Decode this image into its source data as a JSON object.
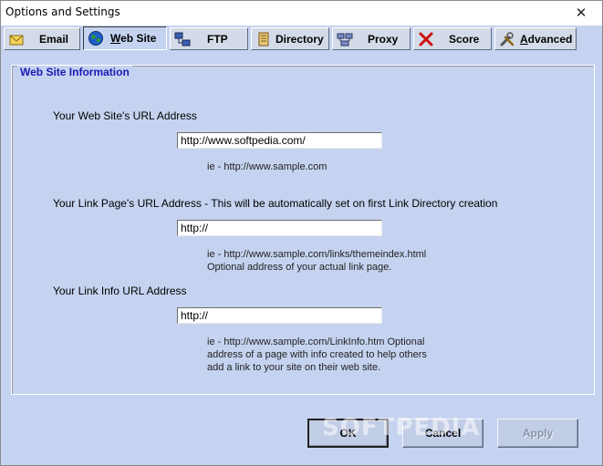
{
  "window": {
    "title": "Options and Settings",
    "close_glyph": "✕"
  },
  "tabs": [
    {
      "label": "Email",
      "mnemonic": "",
      "icon": "envelope-icon",
      "active": false
    },
    {
      "label": "Web Site",
      "mnemonic": "W",
      "icon": "globe-icon",
      "active": true
    },
    {
      "label": "FTP",
      "mnemonic": "",
      "icon": "network-icon",
      "active": false
    },
    {
      "label": "Directory",
      "mnemonic": "",
      "icon": "directory-icon",
      "active": false
    },
    {
      "label": "Proxy",
      "mnemonic": "",
      "icon": "proxy-icon",
      "active": false
    },
    {
      "label": "Score",
      "mnemonic": "",
      "icon": "score-x-icon",
      "active": false
    },
    {
      "label": "Advanced",
      "mnemonic": "A",
      "icon": "tools-icon",
      "active": false
    }
  ],
  "panel": {
    "title": "Web Site Information",
    "url_label": "Your Web Site's URL Address",
    "url_value": "http://www.softpedia.com/",
    "url_hint": "ie - http://www.sample.com",
    "link_label": "Your Link Page's URL Address - This will be automatically set on first Link Directory creation",
    "link_value": "http://",
    "link_hint_1": "ie - http://www.sample.com/links/themeindex.html",
    "link_hint_2": "Optional address of your actual link page.",
    "info_label": "Your Link Info URL Address",
    "info_value": "http://",
    "info_hint_1": "ie - http://www.sample.com/LinkInfo.htm  Optional",
    "info_hint_2": "address of a page with info created to help others",
    "info_hint_3": "add a link to your site on their web site."
  },
  "buttons": {
    "ok": "OK",
    "cancel": "Cancel",
    "apply": "Apply"
  },
  "watermark": "SOFTPEDIA",
  "colors": {
    "background": "#c5d3f0",
    "group_title": "#1a1ab4",
    "disabled_text": "#8993aa"
  }
}
